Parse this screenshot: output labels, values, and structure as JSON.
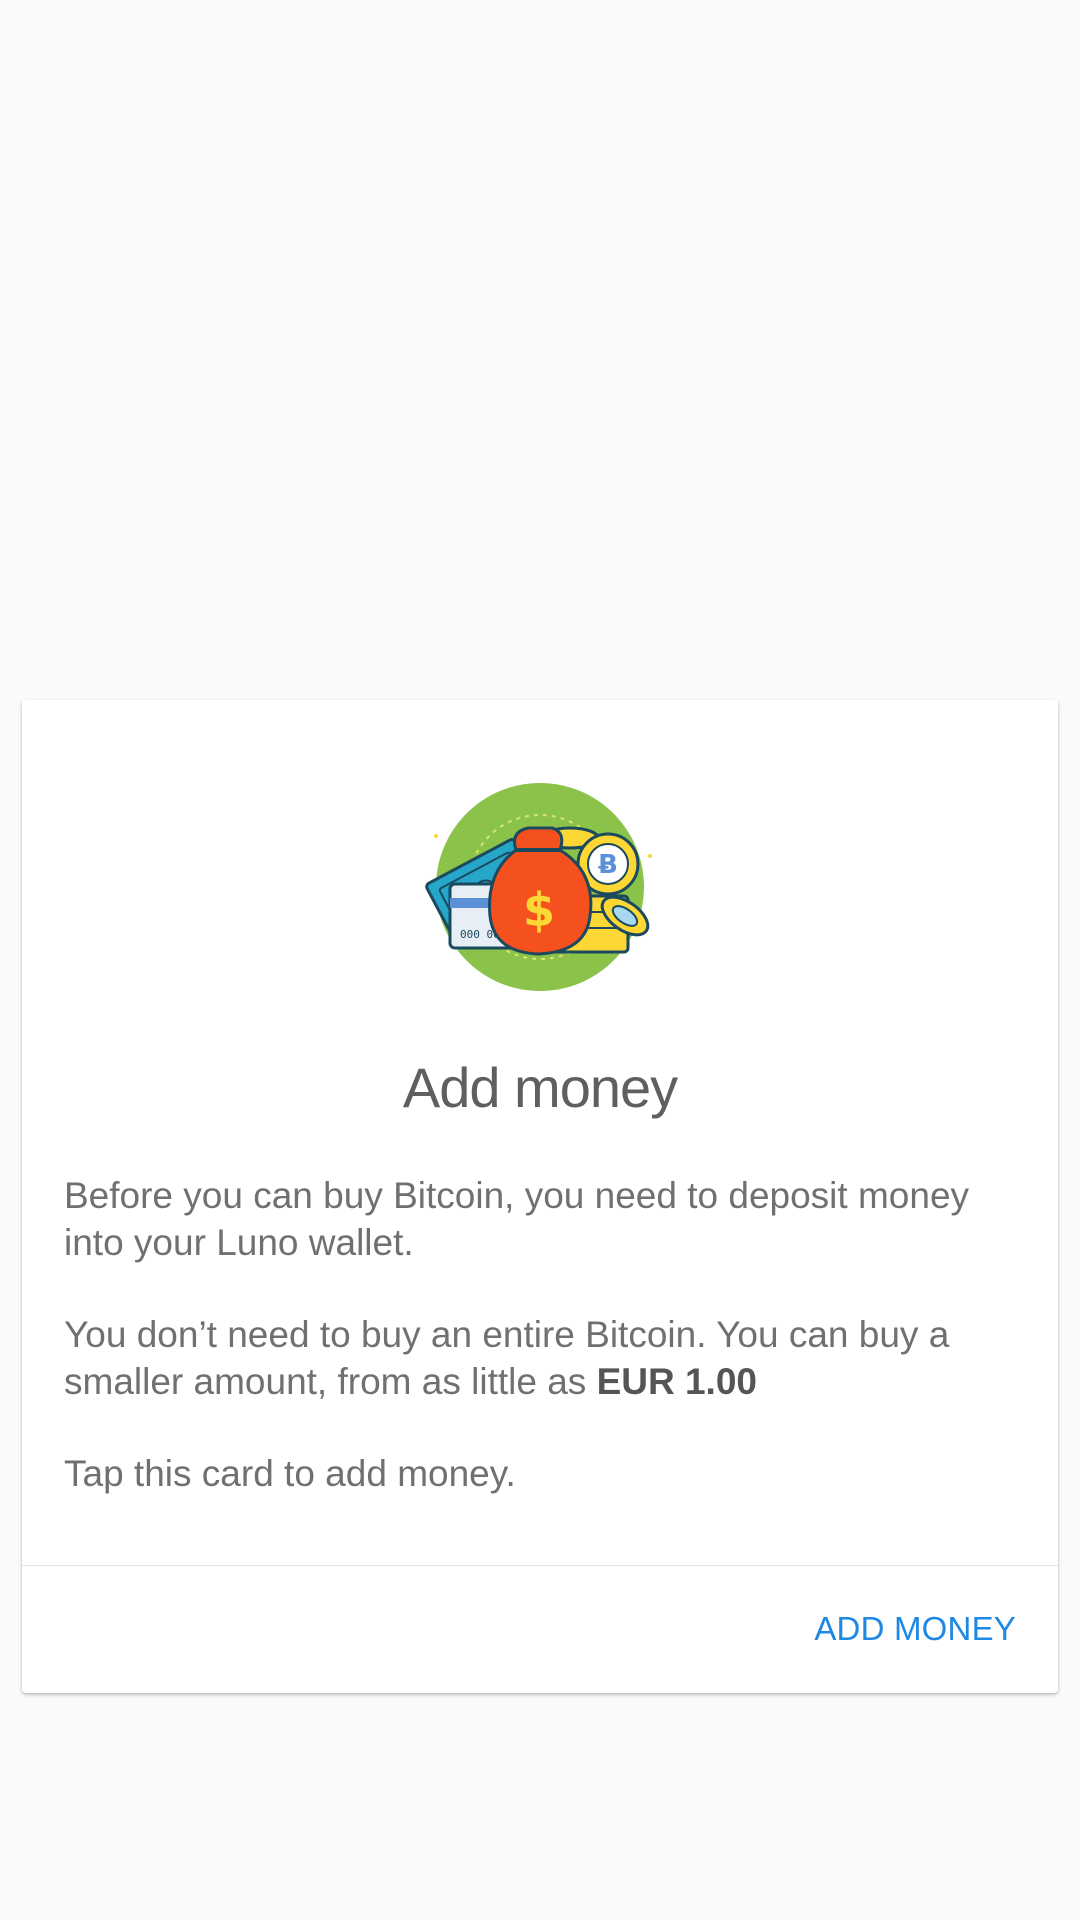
{
  "card": {
    "title": "Add money",
    "paragraph1": "Before you can buy Bitcoin, you need to deposit money into your Luno wallet.",
    "paragraph2_prefix": "You don’t need to buy an entire Bitcoin. You can buy a smaller amount, from as little as ",
    "paragraph2_amount": "EUR 1.00",
    "paragraph3": "Tap this card to add money.",
    "illustration": {
      "icon": "money-bag-coins-illustration",
      "bag_symbol": "$",
      "coin_symbol": "Ƀ",
      "card_number": "000 000"
    },
    "action_label": "ADD MONEY"
  },
  "colors": {
    "accent": "#1e88e5",
    "illustration_circle": "#8bc34a",
    "bag": "#f4511e",
    "coins": "#fdd835",
    "bills": "#26a6c9"
  }
}
